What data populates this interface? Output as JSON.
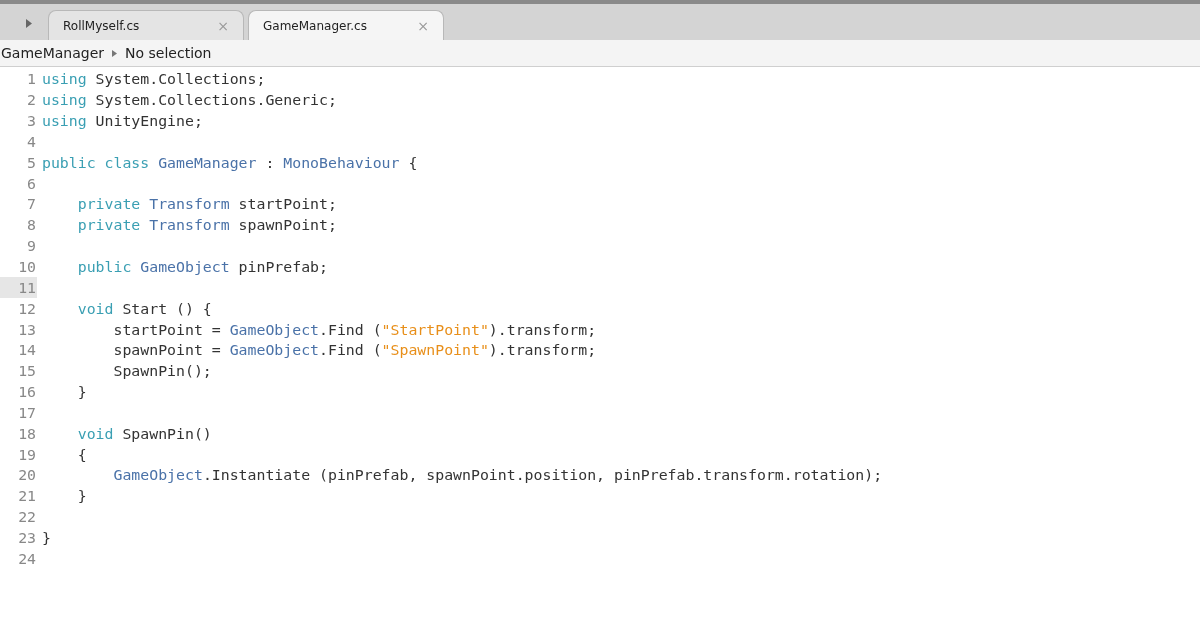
{
  "tabs": [
    {
      "label": "RollMyself.cs",
      "selected": false,
      "close": "×"
    },
    {
      "label": "GameManager.cs",
      "selected": true,
      "close": "×"
    }
  ],
  "breadcrumb": {
    "items": [
      "GameManager",
      "No selection"
    ]
  },
  "editor": {
    "lines": [
      {
        "number": "1",
        "current": false,
        "tokens": [
          {
            "kind": "keyword",
            "text": "using"
          },
          {
            "kind": "plain",
            "text": " System.Collections;"
          }
        ]
      },
      {
        "number": "2",
        "current": false,
        "tokens": [
          {
            "kind": "keyword",
            "text": "using"
          },
          {
            "kind": "plain",
            "text": " System.Collections.Generic;"
          }
        ]
      },
      {
        "number": "3",
        "current": false,
        "tokens": [
          {
            "kind": "keyword",
            "text": "using"
          },
          {
            "kind": "plain",
            "text": " UnityEngine;"
          }
        ]
      },
      {
        "number": "4",
        "current": false
      },
      {
        "number": "5",
        "current": false,
        "tokens": [
          {
            "kind": "keyword",
            "text": "public class"
          },
          {
            "kind": "type",
            "text": " GameManager"
          },
          {
            "kind": "plain",
            "text": " : "
          },
          {
            "kind": "type",
            "text": "MonoBehaviour"
          },
          {
            "kind": "plain",
            "text": " {"
          }
        ]
      },
      {
        "number": "6",
        "current": false
      },
      {
        "number": "7",
        "current": false,
        "tokens": [
          {
            "kind": "keyword",
            "text": "    private"
          },
          {
            "kind": "type",
            "text": " Transform"
          },
          {
            "kind": "plain",
            "text": " startPoint;"
          }
        ]
      },
      {
        "number": "8",
        "current": false,
        "tokens": [
          {
            "kind": "keyword",
            "text": "    private"
          },
          {
            "kind": "type",
            "text": " Transform"
          },
          {
            "kind": "plain",
            "text": " spawnPoint;"
          }
        ]
      },
      {
        "number": "9",
        "current": false
      },
      {
        "number": "10",
        "current": false,
        "tokens": [
          {
            "kind": "keyword",
            "text": "    public"
          },
          {
            "kind": "type",
            "text": " GameObject"
          },
          {
            "kind": "plain",
            "text": " pinPrefab;"
          }
        ]
      },
      {
        "number": "11",
        "current": true
      },
      {
        "number": "12",
        "current": false,
        "tokens": [
          {
            "kind": "keyword",
            "text": "    void"
          },
          {
            "kind": "plain",
            "text": " Start () {"
          }
        ]
      },
      {
        "number": "13",
        "current": false,
        "tokens": [
          {
            "kind": "plain",
            "text": "        startPoint = "
          },
          {
            "kind": "type",
            "text": "GameObject"
          },
          {
            "kind": "plain",
            "text": ".Find ("
          },
          {
            "kind": "string",
            "text": "\"StartPoint\""
          },
          {
            "kind": "plain",
            "text": ").transform;"
          }
        ]
      },
      {
        "number": "14",
        "current": false,
        "tokens": [
          {
            "kind": "plain",
            "text": "        spawnPoint = "
          },
          {
            "kind": "type",
            "text": "GameObject"
          },
          {
            "kind": "plain",
            "text": ".Find ("
          },
          {
            "kind": "string",
            "text": "\"SpawnPoint\""
          },
          {
            "kind": "plain",
            "text": ").transform;"
          }
        ]
      },
      {
        "number": "15",
        "current": false,
        "tokens": [
          {
            "kind": "plain",
            "text": "        SpawnPin();"
          }
        ]
      },
      {
        "number": "16",
        "current": false,
        "tokens": [
          {
            "kind": "plain",
            "text": "    }"
          }
        ]
      },
      {
        "number": "17",
        "current": false
      },
      {
        "number": "18",
        "current": false,
        "tokens": [
          {
            "kind": "keyword",
            "text": "    void"
          },
          {
            "kind": "plain",
            "text": " SpawnPin()"
          }
        ]
      },
      {
        "number": "19",
        "current": false,
        "tokens": [
          {
            "kind": "plain",
            "text": "    {"
          }
        ]
      },
      {
        "number": "20",
        "current": false,
        "tokens": [
          {
            "kind": "type",
            "text": "        GameObject"
          },
          {
            "kind": "plain",
            "text": ".Instantiate (pinPrefab, spawnPoint.position, pinPrefab.transform.rotation);"
          }
        ]
      },
      {
        "number": "21",
        "current": false,
        "tokens": [
          {
            "kind": "plain",
            "text": "    }"
          }
        ]
      },
      {
        "number": "22",
        "current": false
      },
      {
        "number": "23",
        "current": false,
        "tokens": [
          {
            "kind": "plain",
            "text": "}"
          }
        ]
      },
      {
        "number": "24",
        "current": false
      }
    ]
  }
}
